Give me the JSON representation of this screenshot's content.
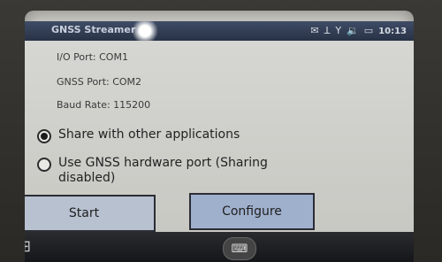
{
  "titlebar": {
    "title": "GNSS Streamer",
    "icons": [
      "message-icon",
      "antenna-icon",
      "signal-icon",
      "volume-icon",
      "battery-icon"
    ],
    "clock": "10:13"
  },
  "info": {
    "io_port": "I/O Port: COM1",
    "gnss_port": "GNSS Port: COM2",
    "baud_rate": "Baud Rate: 115200"
  },
  "options": [
    {
      "label": "Share with other applications",
      "checked": true
    },
    {
      "label": "Use GNSS hardware port (Sharing disabled)",
      "checked": false
    }
  ],
  "buttons": {
    "start": "Start",
    "configure": "Configure"
  },
  "taskbar": {
    "start_icon": "windows-icon",
    "keyboard_icon": "keyboard-icon"
  }
}
